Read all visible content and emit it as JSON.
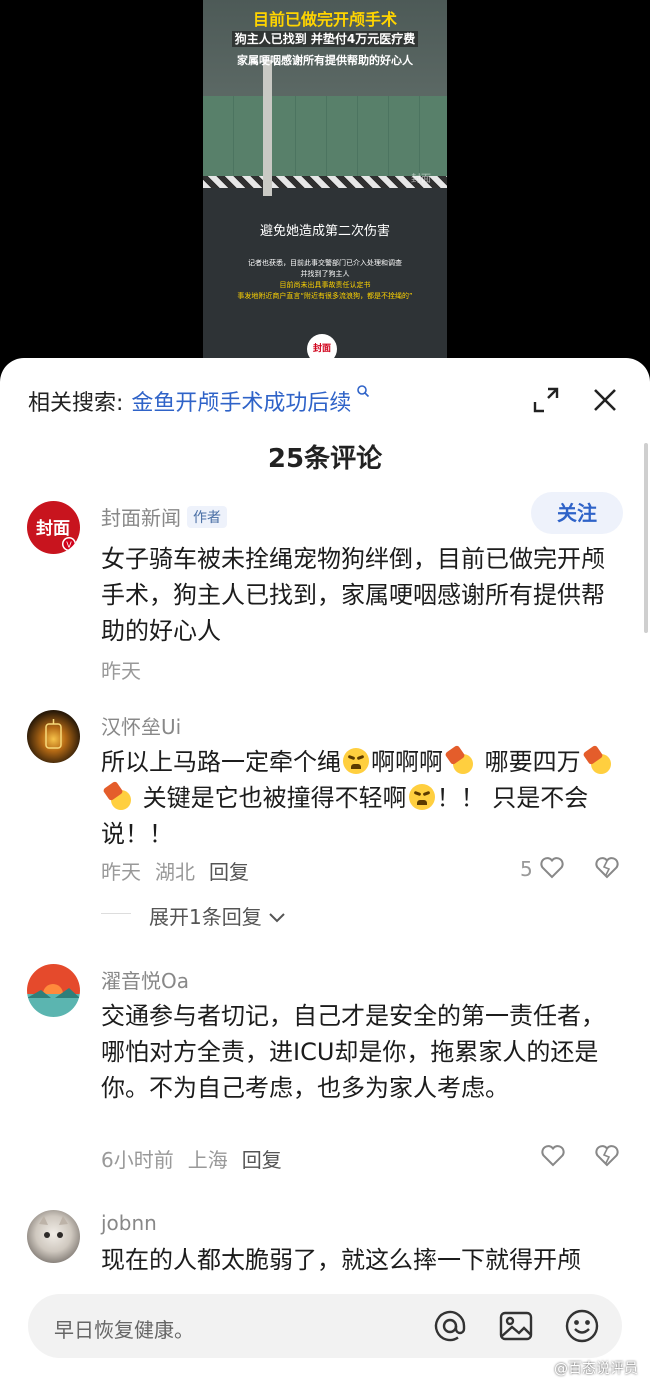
{
  "video": {
    "line1": "目前已做完开颅手术",
    "line2": "狗主人已找到 并垫付4万元医疗费",
    "line3": "家属哽咽感谢所有提供帮助的好心人",
    "subtitle": "避免她造成第二次伤害",
    "small1": "记者也获悉，目前此事交警部门已介入处理和调查",
    "small2": "并找到了狗主人",
    "small3": "目前尚未出具事故责任认定书",
    "small4": "事发地附近商户直言“附近有很多流浪狗，都是不拴绳的”",
    "watermark": "封面",
    "logo": "封面 时刻"
  },
  "related": {
    "label": "相关搜索:",
    "keyword": "金鱼开颅手术成功后续"
  },
  "header": {
    "count": "25条评论"
  },
  "comments": [
    {
      "user": "封面新闻",
      "tag": "作者",
      "follow": "关注",
      "text": "女子骑车被未拴绳宠物狗绊倒，目前已做完开颅手术，狗主人已找到，家属哽咽感谢所有提供帮助的好心人",
      "time": "昨天"
    },
    {
      "user": "汉怀垒Ui",
      "t1": "所以上马路一定牵个绳",
      "t2": "啊啊啊",
      "t3": " 哪要四万",
      "t4": " 关键是它也被撞得不轻啊",
      "t5": "！！ 只是不会说！！",
      "time": "昨天",
      "location": "湖北",
      "reply": "回复",
      "likes": "5",
      "expand": "展开1条回复"
    },
    {
      "user": "濯音悦Oa",
      "text": "交通参与者切记，自己才是安全的第一责任者，哪怕对方全责，进ICU却是你，拖累家人的还是你。不为自己考虑，也多为家人考虑。",
      "time": "6小时前",
      "location": "上海",
      "reply": "回复"
    },
    {
      "user": "jobnn",
      "text": "现在的人都太脆弱了，就这么摔一下就得开颅"
    }
  ],
  "input": {
    "placeholder": "早日恢复健康。"
  },
  "footer": {
    "watermark": "@百态说评员"
  },
  "colors": {
    "accent": "#2f63c8",
    "brand_red": "#d0021b"
  },
  "icons": [
    "search-icon",
    "expand-icon",
    "close-icon",
    "heart-icon",
    "dislike-icon",
    "at-icon",
    "image-icon",
    "emoji-icon",
    "chevron-down-icon"
  ]
}
